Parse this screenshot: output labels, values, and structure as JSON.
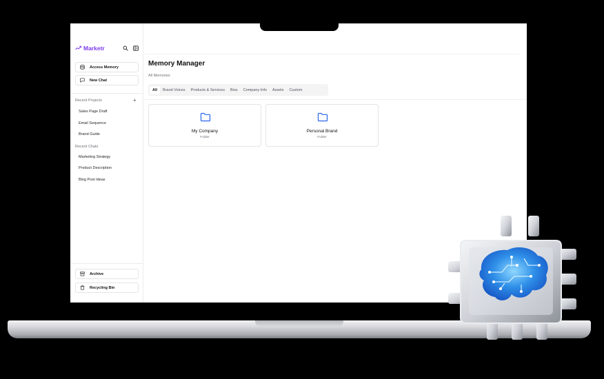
{
  "app": {
    "brand": "Marketr"
  },
  "sidebar": {
    "access_memory": "Access Memory",
    "new_chat": "New Chat",
    "recent_projects_title": "Recent Projects",
    "projects": [
      "Sales Page Draft",
      "Email Sequence",
      "Brand Guide"
    ],
    "recent_chats_title": "Recent Chats",
    "chats": [
      "Marketing Strategy",
      "Product Description",
      "Blog Post Ideas"
    ],
    "archive": "Archive",
    "recycling_bin": "Recycling Bin"
  },
  "main": {
    "title": "Memory Manager",
    "breadcrumb": "All Memories",
    "tabs": [
      {
        "label": "All",
        "active": true
      },
      {
        "label": "Brand Voices",
        "active": false
      },
      {
        "label": "Products & Services",
        "active": false
      },
      {
        "label": "Bios",
        "active": false
      },
      {
        "label": "Company Info",
        "active": false
      },
      {
        "label": "Assets",
        "active": false
      },
      {
        "label": "Custom",
        "active": false
      }
    ],
    "folders": [
      {
        "name": "My Company",
        "type": "Folder"
      },
      {
        "name": "Personal Brand",
        "type": "Folder"
      }
    ]
  },
  "icons": {
    "brand": "trending-up-icon",
    "search": "search-icon",
    "sidebar_toggle": "sidebar-toggle-icon",
    "database": "database-icon",
    "chat": "chat-bubble-icon",
    "plus": "plus-icon",
    "archive": "archive-icon",
    "trash": "trash-icon",
    "folder": "folder-icon",
    "chip": "ai-brain-chip-icon"
  },
  "colors": {
    "accent": "#7c3aed",
    "folder_blue": "#2563eb"
  }
}
